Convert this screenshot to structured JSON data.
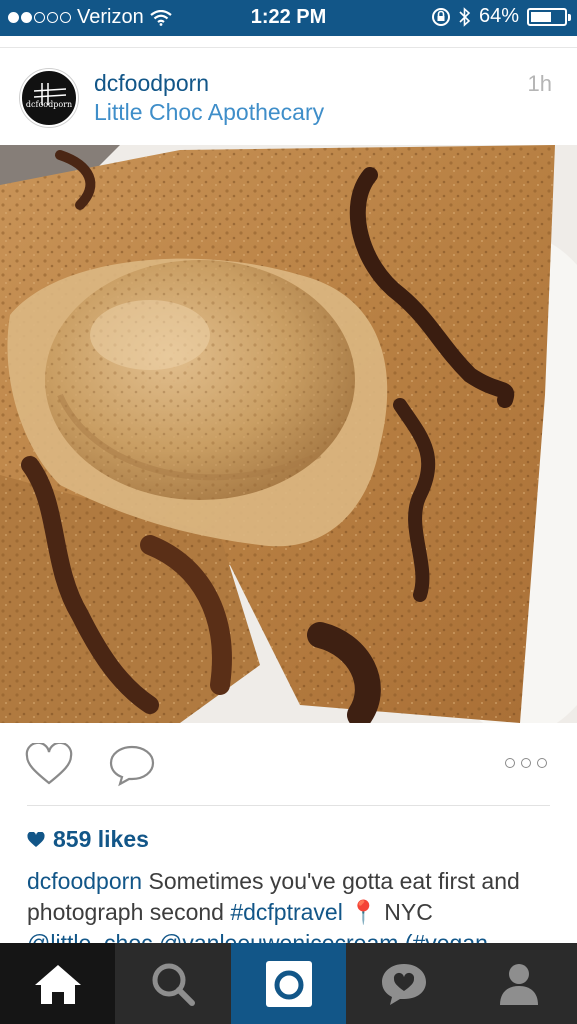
{
  "status_bar": {
    "carrier": "Verizon",
    "time": "1:22 PM",
    "battery_percent": "64%",
    "battery_level": 0.64,
    "signal_bars_filled": 2,
    "signal_bars_total": 5
  },
  "post": {
    "username": "dcfoodporn",
    "avatar_text": "dcfoodporn",
    "location": "Little Choc Apothecary",
    "timestamp": "1h",
    "likes": "859 likes",
    "caption": {
      "username": "dcfoodporn",
      "text": " Sometimes you've gotta eat first and photograph second ",
      "hashtag": "#dcfptravel",
      "pin_emoji": "📍",
      "after_pin": " NYC",
      "mentions": "@little_choc @vanleeuwenicecream (#vegan"
    }
  },
  "colors": {
    "brand_blue": "#125688",
    "link_blue": "#3f8ec9",
    "tab_bar": "#2b2b2b"
  },
  "tabs": [
    "home-icon",
    "search-icon",
    "camera-icon",
    "activity-icon",
    "profile-icon"
  ]
}
